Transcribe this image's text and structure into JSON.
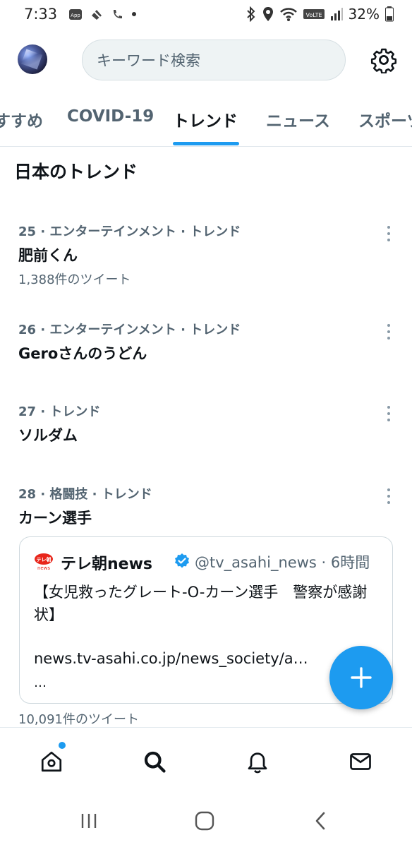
{
  "status_bar": {
    "time": "7:33",
    "app_badge": "App",
    "battery": "32%",
    "network_label": "VoLTE",
    "icons": [
      "app-icon",
      "do-not-disturb-icon",
      "wifi-call-icon",
      "dot-icon",
      "bluetooth-icon",
      "location-icon",
      "wifi-icon",
      "signal-icon",
      "battery-icon"
    ]
  },
  "header": {
    "search_placeholder": "キーワード検索",
    "avatar": "avatar",
    "settings_icon": "gear-icon"
  },
  "tabs": {
    "items": [
      "すすめ",
      "COVID-19",
      "トレンド",
      "ニュース",
      "スポーツ"
    ],
    "active": "トレンド"
  },
  "section": {
    "title": "日本のトレンド"
  },
  "trends": [
    {
      "meta": "25 · エンターテインメント · トレンド",
      "name": "肥前くん",
      "count": "1,388件のツイート"
    },
    {
      "meta": "26 · エンターテインメント · トレンド",
      "name": "Geroさんのうどん",
      "count": ""
    },
    {
      "meta": "27 · トレンド",
      "name": "ソルダム",
      "count": ""
    },
    {
      "meta": "28 · 格闘技 · トレンド",
      "name": "カーン選手",
      "count": "10,091件のツイート"
    }
  ],
  "tweet_card": {
    "logo_text": "テレ朝",
    "logo_sub": "news",
    "account_name": "テレ朝news",
    "handle_time": "@tv_asahi_news · 6時間",
    "body": "【女児救ったグレート-O-カーン選手　警察が感謝状】",
    "link": "news.tv-asahi.co.jp/news_society/a…",
    "ellipsis": "…"
  },
  "fab": {
    "icon": "plus-icon"
  },
  "bottom_nav": [
    "home-icon",
    "search-icon",
    "bell-icon",
    "mail-icon"
  ],
  "android_nav": [
    "recents-icon",
    "home-button-icon",
    "back-icon"
  ],
  "colors": {
    "accent": "#1d9bf0",
    "text_primary": "#0f1419",
    "text_secondary": "#536471",
    "border": "#e1e8ed",
    "logo_red": "#e8261b"
  }
}
